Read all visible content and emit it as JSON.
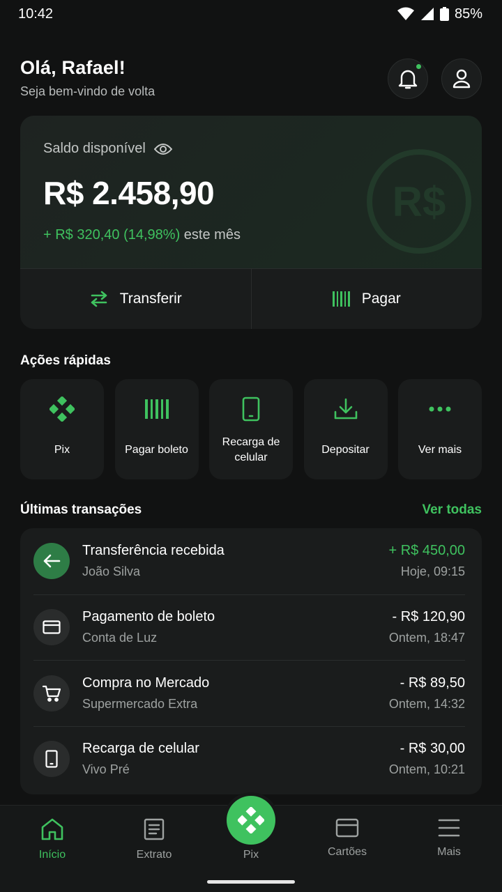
{
  "status_bar": {
    "time": "10:42",
    "battery": "85%"
  },
  "header": {
    "greeting": "Olá, Rafael!",
    "subtitle": "Seja bem-vindo de volta"
  },
  "balance": {
    "label": "Saldo disponível",
    "amount": "R$ 2.458,90",
    "change_value": "+ R$ 320,40 (14,98%)",
    "change_suffix": " este mês",
    "watermark": "R$",
    "actions": {
      "transfer": "Transferir",
      "pay": "Pagar"
    }
  },
  "quick_actions": {
    "title": "Ações rápidas",
    "items": [
      {
        "label": "Pix",
        "icon": "pix-icon"
      },
      {
        "label": "Pagar boleto",
        "icon": "barcode-icon"
      },
      {
        "label": "Recarga de celular",
        "icon": "phone-icon"
      },
      {
        "label": "Depositar",
        "icon": "download-icon"
      },
      {
        "label": "Ver mais",
        "icon": "more-icon"
      }
    ]
  },
  "transactions": {
    "title": "Últimas transações",
    "see_all": "Ver todas",
    "items": [
      {
        "title": "Transferência recebida",
        "subtitle": "João Silva",
        "amount": "+ R$ 450,00",
        "time": "Hoje, 09:15",
        "icon": "arrow-left-icon"
      },
      {
        "title": "Pagamento de boleto",
        "subtitle": "Conta de Luz",
        "amount": "- R$ 120,90",
        "time": "Ontem, 18:47",
        "icon": "card-icon"
      },
      {
        "title": "Compra no Mercado",
        "subtitle": "Supermercado Extra",
        "amount": "- R$ 89,50",
        "time": "Ontem, 14:32",
        "icon": "cart-icon"
      },
      {
        "title": "Recarga de celular",
        "subtitle": "Vivo Pré",
        "amount": "- R$ 30,00",
        "time": "Ontem, 10:21",
        "icon": "phone-icon"
      }
    ]
  },
  "bottom_nav": {
    "items": [
      {
        "label": "Início",
        "icon": "home-icon"
      },
      {
        "label": "Extrato",
        "icon": "document-icon"
      },
      {
        "label": "Pix",
        "icon": "pix-icon"
      },
      {
        "label": "Cartões",
        "icon": "card-icon"
      },
      {
        "label": "Mais",
        "icon": "menu-icon"
      }
    ]
  },
  "colors": {
    "accent": "#3fc25f",
    "background": "#111212",
    "card": "#1a1c1c"
  }
}
